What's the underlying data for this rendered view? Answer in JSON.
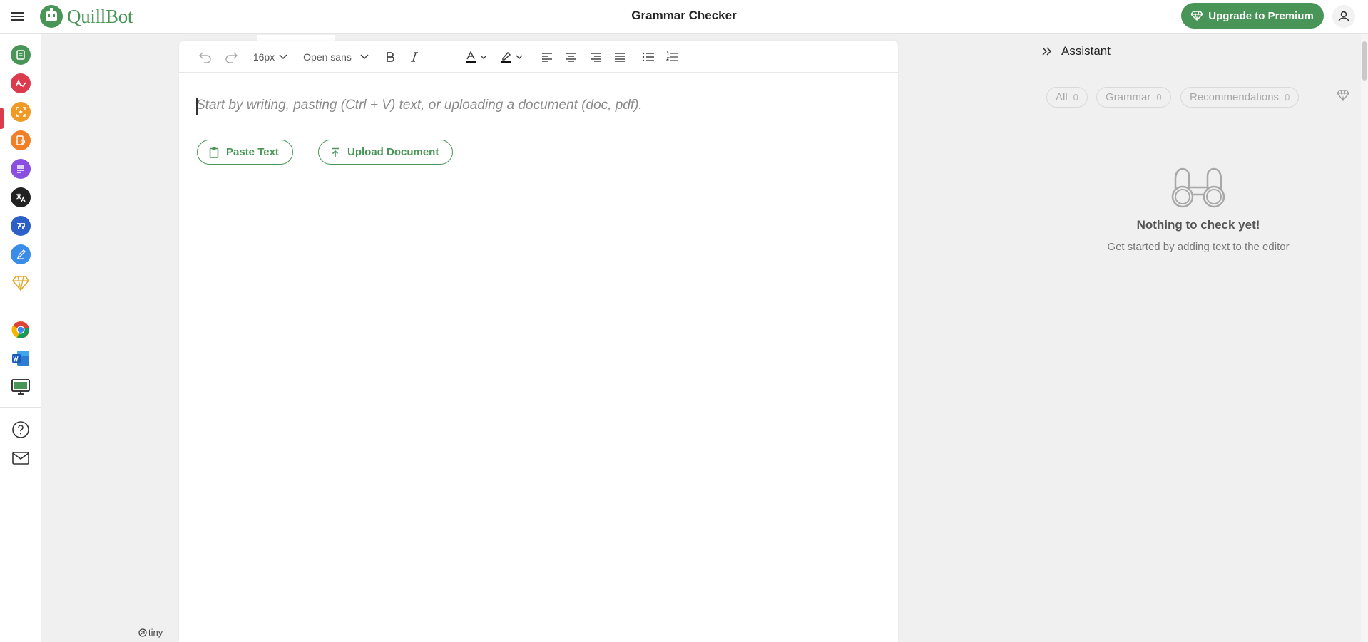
{
  "app": {
    "logo_text": "QuillBot",
    "page_title": "Grammar Checker",
    "upgrade_label": "Upgrade to Premium"
  },
  "colors": {
    "brand_green": "#499557",
    "active_red": "#dc3b4d"
  },
  "sidebar": {
    "items": [
      {
        "name": "paraphraser",
        "icon": "paraphraser-icon",
        "color": "#499557"
      },
      {
        "name": "grammar-checker",
        "icon": "grammar-check-icon",
        "color": "#dc3b4d",
        "active": true
      },
      {
        "name": "ai-detector",
        "icon": "ai-detector-icon",
        "color": "#f09a26"
      },
      {
        "name": "plagiarism-checker",
        "icon": "plagiarism-icon",
        "color": "#f07f26"
      },
      {
        "name": "summarizer",
        "icon": "summarizer-icon",
        "color": "#8a4fe0"
      },
      {
        "name": "translator",
        "icon": "translator-icon",
        "color": "#222222"
      },
      {
        "name": "citation-generator",
        "icon": "citation-icon",
        "color": "#2c5fc7"
      },
      {
        "name": "quillbot-flow",
        "icon": "flow-pen-icon",
        "color": "#3b8ce8"
      },
      {
        "name": "premium",
        "icon": "premium-diamond-icon",
        "color": "#e3a92b"
      },
      {
        "name": "chrome-extension",
        "icon": "chrome-icon"
      },
      {
        "name": "word-addin",
        "icon": "word-icon"
      },
      {
        "name": "desktop-app",
        "icon": "desktop-icon"
      },
      {
        "name": "help",
        "icon": "help-icon"
      },
      {
        "name": "contact",
        "icon": "mail-icon"
      }
    ]
  },
  "toolbar": {
    "font_size": "16px",
    "font_family": "Open sans"
  },
  "editor": {
    "placeholder": "Start by writing, pasting (Ctrl + V) text, or uploading a document (doc, pdf).",
    "paste_label": "Paste Text",
    "upload_label": "Upload Document",
    "tiny_label": "tiny"
  },
  "assistant": {
    "title": "Assistant",
    "filters": [
      {
        "label": "All",
        "count": "0"
      },
      {
        "label": "Grammar",
        "count": "0"
      },
      {
        "label": "Recommendations",
        "count": "0"
      }
    ],
    "empty_title": "Nothing to check yet!",
    "empty_subtitle": "Get started by adding text to the editor"
  }
}
